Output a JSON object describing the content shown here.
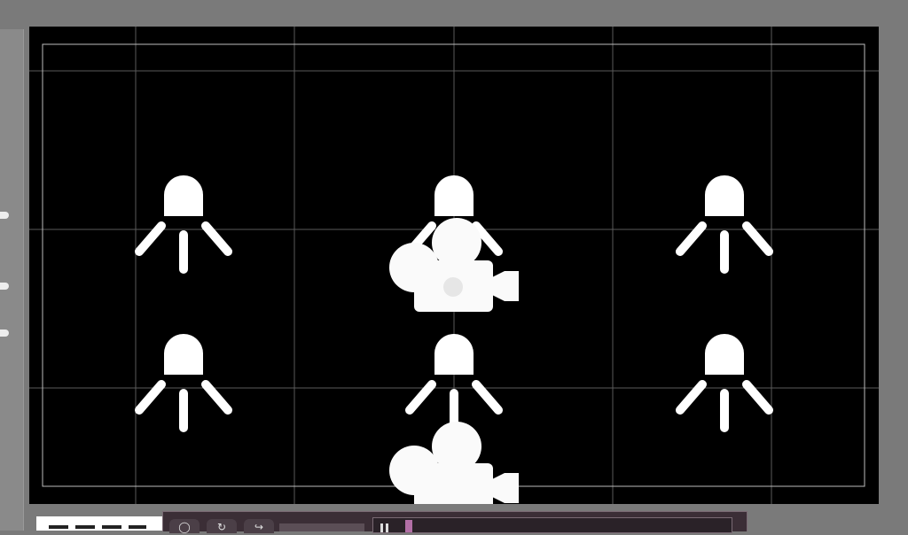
{
  "scene": {
    "background_color": "#000000",
    "gridline_color": "#5a5a5a",
    "frame_color": "#bdbdbd",
    "light_count": 6,
    "camera_count": 2,
    "light_icon": "spotlight-icon",
    "camera_icon": "movie-camera-icon"
  },
  "left_panel": {
    "handles": [
      "panel-handle",
      "panel-handle",
      "panel-handle"
    ]
  },
  "bottom_toolbar": {
    "buttons": [
      {
        "icon": "zoom-icon",
        "glyph": "◯"
      },
      {
        "icon": "refresh-icon",
        "glyph": "↻"
      },
      {
        "icon": "redo-icon",
        "glyph": "↪"
      }
    ],
    "play_icon": "pause-icon",
    "accent": "#b26fa6"
  }
}
